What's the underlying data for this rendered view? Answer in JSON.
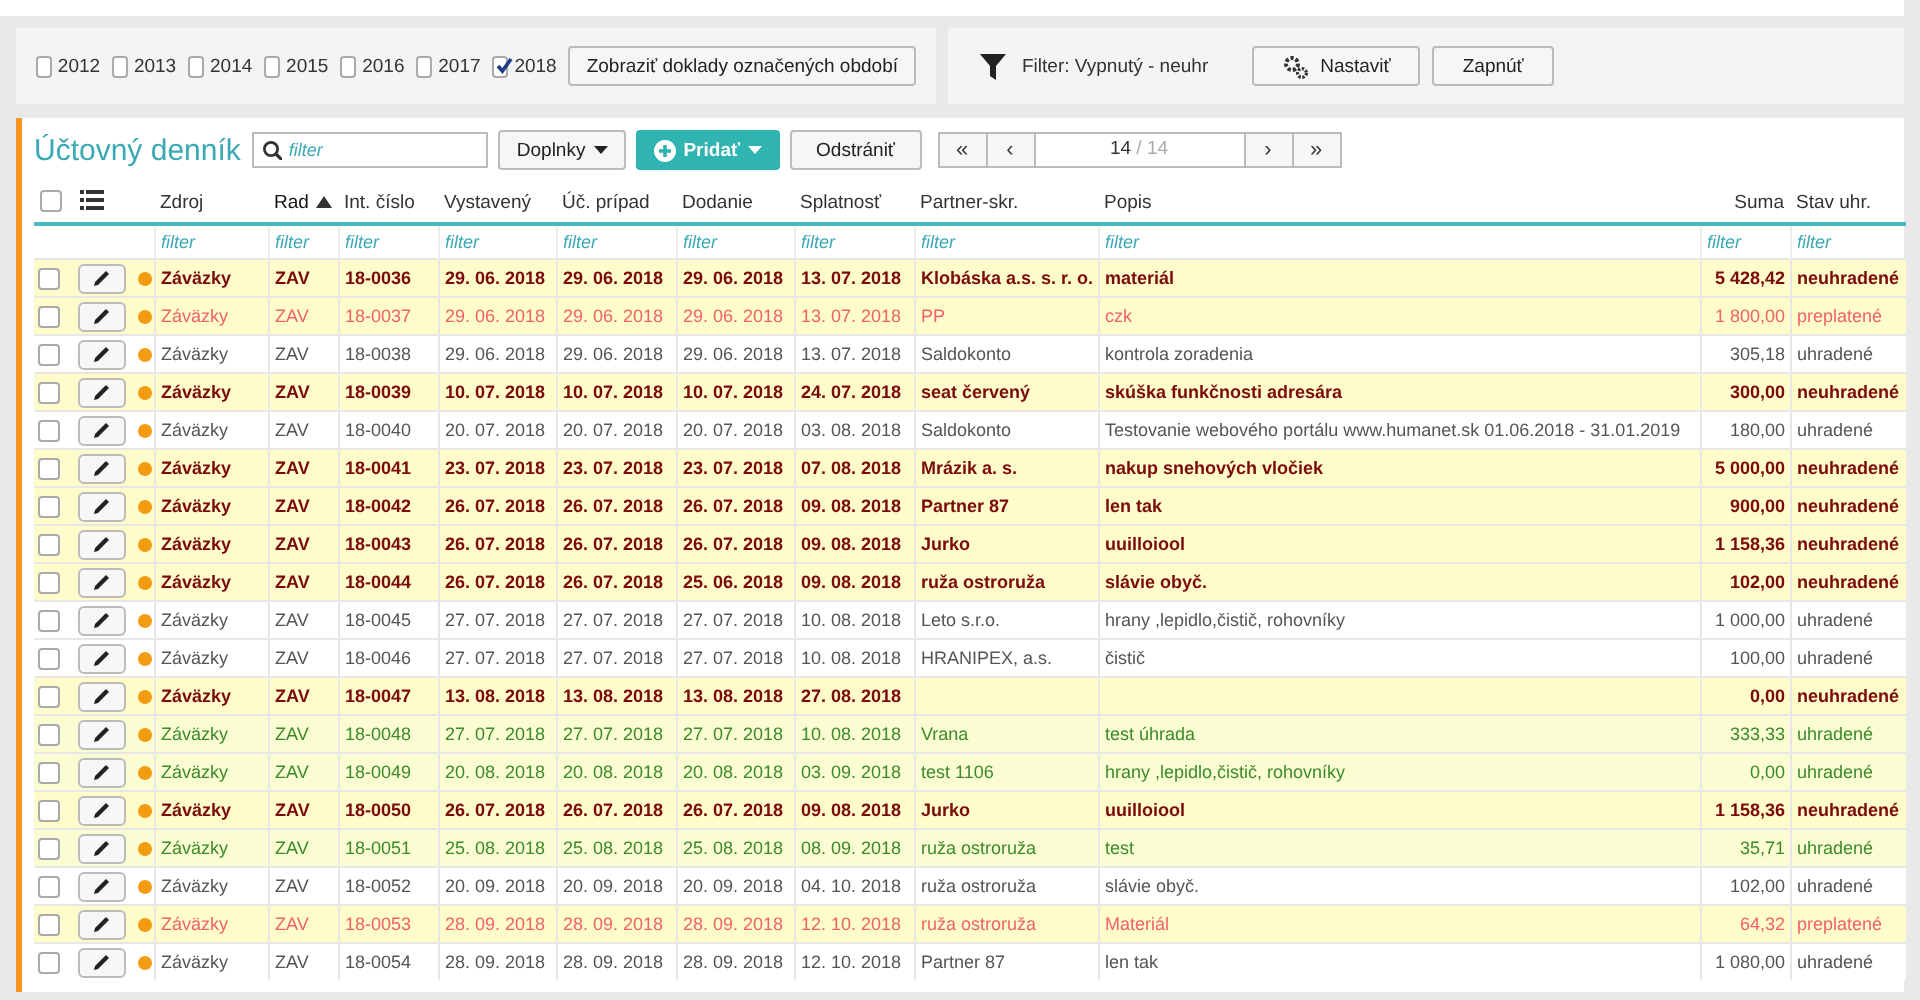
{
  "periods": [
    {
      "label": "2012",
      "checked": false
    },
    {
      "label": "2013",
      "checked": false
    },
    {
      "label": "2014",
      "checked": false
    },
    {
      "label": "2015",
      "checked": false
    },
    {
      "label": "2016",
      "checked": false
    },
    {
      "label": "2017",
      "checked": false
    },
    {
      "label": "2018",
      "checked": true
    }
  ],
  "show_button": "Zobraziť doklady označených období",
  "filter_panel": {
    "status": "Filter: Vypnutý - neuhr",
    "settings_button": "Nastaviť",
    "enable_button": "Zapnúť"
  },
  "journal": {
    "title": "Účtovný denník",
    "search": {
      "placeholder": "filter"
    },
    "toolbar": {
      "extras": "Doplnky",
      "add": "Pridať",
      "remove": "Odstrániť"
    },
    "pager": {
      "first": "«",
      "prev": "‹",
      "page": "14",
      "total": "/ 14",
      "next": "›",
      "last": "»"
    },
    "select_all": {
      "checked": false
    },
    "columns": [
      {
        "label": "Zdroj",
        "sorted": false,
        "filter_placeholder": "filter"
      },
      {
        "label": "Rad",
        "sorted": true,
        "filter_placeholder": "filter"
      },
      {
        "label": "Int. číslo",
        "sorted": false,
        "filter_placeholder": "filter"
      },
      {
        "label": "Vystavený",
        "sorted": false,
        "filter_placeholder": "filter"
      },
      {
        "label": "Úč. prípad",
        "sorted": false,
        "filter_placeholder": "filter"
      },
      {
        "label": "Dodanie",
        "sorted": false,
        "filter_placeholder": "filter"
      },
      {
        "label": "Splatnosť",
        "sorted": false,
        "filter_placeholder": "filter"
      },
      {
        "label": "Partner-skr.",
        "sorted": false,
        "filter_placeholder": "filter"
      },
      {
        "label": "Popis",
        "sorted": false,
        "filter_placeholder": "filter"
      },
      {
        "label": "Suma",
        "sorted": false,
        "filter_placeholder": "filter"
      },
      {
        "label": "Stav uhr.",
        "sorted": false,
        "filter_placeholder": "filter"
      }
    ],
    "rows": [
      {
        "kind": "unpaid",
        "checked": false,
        "cells": [
          "Záväzky",
          "ZAV",
          "18-0036",
          "29. 06. 2018",
          "29. 06. 2018",
          "29. 06. 2018",
          "13. 07. 2018",
          "Klobáska a.s. s. r. o.",
          "materiál",
          "5 428,42",
          "neuhradené"
        ]
      },
      {
        "kind": "overpaid",
        "checked": false,
        "cells": [
          "Záväzky",
          "ZAV",
          "18-0037",
          "29. 06. 2018",
          "29. 06. 2018",
          "29. 06. 2018",
          "13. 07. 2018",
          "PP",
          "czk",
          "1 800,00",
          "preplatené"
        ]
      },
      {
        "kind": "paid",
        "checked": false,
        "cells": [
          "Záväzky",
          "ZAV",
          "18-0038",
          "29. 06. 2018",
          "29. 06. 2018",
          "29. 06. 2018",
          "13. 07. 2018",
          "Saldokonto",
          "kontrola zoradenia",
          "305,18",
          "uhradené"
        ]
      },
      {
        "kind": "unpaid",
        "checked": false,
        "cells": [
          "Záväzky",
          "ZAV",
          "18-0039",
          "10. 07. 2018",
          "10. 07. 2018",
          "10. 07. 2018",
          "24. 07. 2018",
          "seat červený",
          "skúška funkčnosti adresára",
          "300,00",
          "neuhradené"
        ]
      },
      {
        "kind": "paid",
        "checked": false,
        "cells": [
          "Záväzky",
          "ZAV",
          "18-0040",
          "20. 07. 2018",
          "20. 07. 2018",
          "20. 07. 2018",
          "03. 08. 2018",
          "Saldokonto",
          "Testovanie webového portálu www.humanet.sk 01.06.2018 - 31.01.2019",
          "180,00",
          "uhradené"
        ]
      },
      {
        "kind": "unpaid",
        "checked": false,
        "cells": [
          "Záväzky",
          "ZAV",
          "18-0041",
          "23. 07. 2018",
          "23. 07. 2018",
          "23. 07. 2018",
          "07. 08. 2018",
          "Mrázik a. s.",
          "nakup snehových vločiek",
          "5 000,00",
          "neuhradené"
        ]
      },
      {
        "kind": "unpaid",
        "checked": false,
        "cells": [
          "Záväzky",
          "ZAV",
          "18-0042",
          "26. 07. 2018",
          "26. 07. 2018",
          "26. 07. 2018",
          "09. 08. 2018",
          "Partner 87",
          "len tak",
          "900,00",
          "neuhradené"
        ]
      },
      {
        "kind": "unpaid",
        "checked": false,
        "cells": [
          "Záväzky",
          "ZAV",
          "18-0043",
          "26. 07. 2018",
          "26. 07. 2018",
          "26. 07. 2018",
          "09. 08. 2018",
          "Jurko",
          "uuilloiool",
          "1 158,36",
          "neuhradené"
        ]
      },
      {
        "kind": "unpaid",
        "checked": false,
        "cells": [
          "Záväzky",
          "ZAV",
          "18-0044",
          "26. 07. 2018",
          "26. 07. 2018",
          "25. 06. 2018",
          "09. 08. 2018",
          "ruža ostroruža",
          "slávie obyč.",
          "102,00",
          "neuhradené"
        ]
      },
      {
        "kind": "paid",
        "checked": false,
        "cells": [
          "Záväzky",
          "ZAV",
          "18-0045",
          "27. 07. 2018",
          "27. 07. 2018",
          "27. 07. 2018",
          "10. 08. 2018",
          "Leto s.r.o.",
          "hrany ,lepidlo,čistič, rohovníky",
          "1 000,00",
          "uhradené"
        ]
      },
      {
        "kind": "paid",
        "checked": false,
        "cells": [
          "Záväzky",
          "ZAV",
          "18-0046",
          "27. 07. 2018",
          "27. 07. 2018",
          "27. 07. 2018",
          "10. 08. 2018",
          "HRANIPEX, a.s.",
          "čistič",
          "100,00",
          "uhradené"
        ]
      },
      {
        "kind": "unpaid",
        "checked": false,
        "cells": [
          "Záväzky",
          "ZAV",
          "18-0047",
          "13. 08. 2018",
          "13. 08. 2018",
          "13. 08. 2018",
          "27. 08. 2018",
          "",
          "",
          "0,00",
          "neuhradené"
        ]
      },
      {
        "kind": "paid_marked",
        "checked": false,
        "cells": [
          "Záväzky",
          "ZAV",
          "18-0048",
          "27. 07. 2018",
          "27. 07. 2018",
          "27. 07. 2018",
          "10. 08. 2018",
          "Vrana",
          "test úhrada",
          "333,33",
          "uhradené"
        ]
      },
      {
        "kind": "paid_marked",
        "checked": false,
        "cells": [
          "Záväzky",
          "ZAV",
          "18-0049",
          "20. 08. 2018",
          "20. 08. 2018",
          "20. 08. 2018",
          "03. 09. 2018",
          "test 1106",
          "hrany ,lepidlo,čistič, rohovníky",
          "0,00",
          "uhradené"
        ]
      },
      {
        "kind": "unpaid",
        "checked": false,
        "cells": [
          "Záväzky",
          "ZAV",
          "18-0050",
          "26. 07. 2018",
          "26. 07. 2018",
          "26. 07. 2018",
          "09. 08. 2018",
          "Jurko",
          "uuilloiool",
          "1 158,36",
          "neuhradené"
        ]
      },
      {
        "kind": "paid_marked",
        "checked": false,
        "cells": [
          "Záväzky",
          "ZAV",
          "18-0051",
          "25. 08. 2018",
          "25. 08. 2018",
          "25. 08. 2018",
          "08. 09. 2018",
          "ruža ostroruža",
          "test",
          "35,71",
          "uhradené"
        ]
      },
      {
        "kind": "paid",
        "checked": false,
        "cells": [
          "Záväzky",
          "ZAV",
          "18-0052",
          "20. 09. 2018",
          "20. 09. 2018",
          "20. 09. 2018",
          "04. 10. 2018",
          "ruža ostroruža",
          "slávie obyč.",
          "102,00",
          "uhradené"
        ]
      },
      {
        "kind": "overpaid",
        "checked": false,
        "cells": [
          "Záväzky",
          "ZAV",
          "18-0053",
          "28. 09. 2018",
          "28. 09. 2018",
          "28. 09. 2018",
          "12. 10. 2018",
          "ruža ostroruža",
          "Materiál",
          "64,32",
          "preplatené"
        ]
      },
      {
        "kind": "paid",
        "checked": false,
        "cells": [
          "Záväzky",
          "ZAV",
          "18-0054",
          "28. 09. 2018",
          "28. 09. 2018",
          "28. 09. 2018",
          "12. 10. 2018",
          "Partner 87",
          "len tak",
          "1 080,00",
          "uhradené"
        ]
      }
    ]
  }
}
